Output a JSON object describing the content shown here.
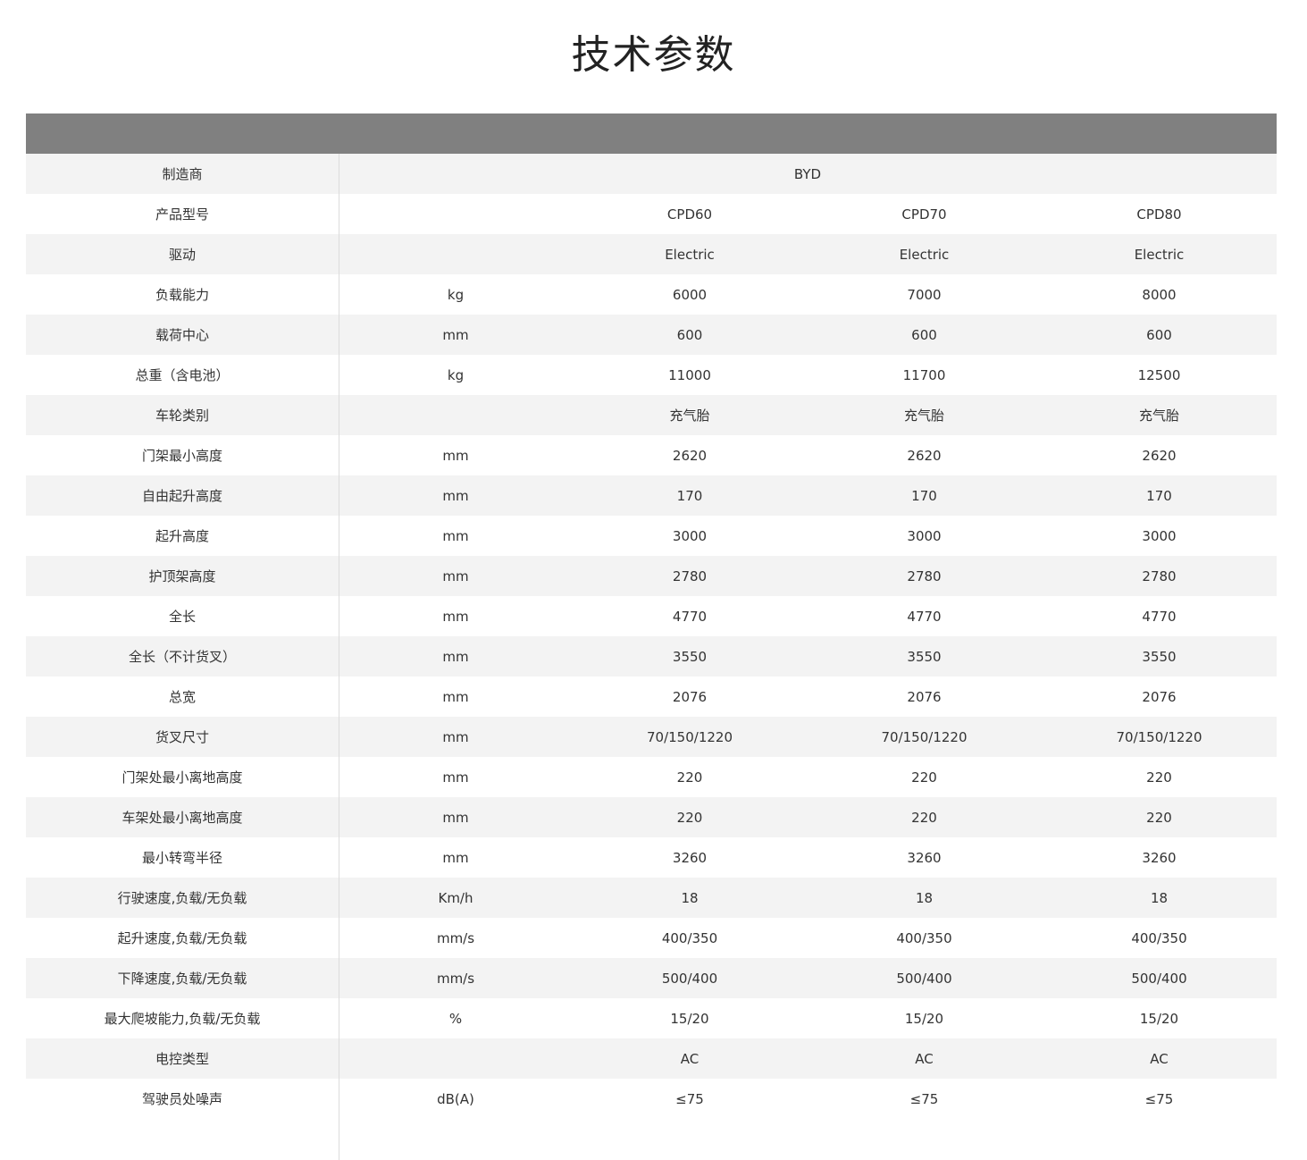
{
  "page": {
    "title": "技术参数"
  },
  "manufacturer": {
    "label": "制造商",
    "value": "BYD"
  },
  "rows": [
    {
      "label": "产品型号",
      "unit": "",
      "values": [
        "CPD60",
        "CPD70",
        "CPD80"
      ]
    },
    {
      "label": "驱动",
      "unit": "",
      "values": [
        "Electric",
        "Electric",
        "Electric"
      ]
    },
    {
      "label": "负载能力",
      "unit": "kg",
      "values": [
        "6000",
        "7000",
        "8000"
      ]
    },
    {
      "label": "载荷中心",
      "unit": "mm",
      "values": [
        "600",
        "600",
        "600"
      ]
    },
    {
      "label": "总重（含电池）",
      "unit": "kg",
      "values": [
        "11000",
        "11700",
        "12500"
      ]
    },
    {
      "label": "车轮类别",
      "unit": "",
      "values": [
        "充气胎",
        "充气胎",
        "充气胎"
      ]
    },
    {
      "label": "门架最小高度",
      "unit": "mm",
      "values": [
        "2620",
        "2620",
        "2620"
      ]
    },
    {
      "label": "自由起升高度",
      "unit": "mm",
      "values": [
        "170",
        "170",
        "170"
      ]
    },
    {
      "label": "起升高度",
      "unit": "mm",
      "values": [
        "3000",
        "3000",
        "3000"
      ]
    },
    {
      "label": "护顶架高度",
      "unit": "mm",
      "values": [
        "2780",
        "2780",
        "2780"
      ]
    },
    {
      "label": "全长",
      "unit": "mm",
      "values": [
        "4770",
        "4770",
        "4770"
      ]
    },
    {
      "label": "全长（不计货叉）",
      "unit": "mm",
      "values": [
        "3550",
        "3550",
        "3550"
      ]
    },
    {
      "label": "总宽",
      "unit": "mm",
      "values": [
        "2076",
        "2076",
        "2076"
      ]
    },
    {
      "label": "货叉尺寸",
      "unit": "mm",
      "values": [
        "70/150/1220",
        "70/150/1220",
        "70/150/1220"
      ]
    },
    {
      "label": "门架处最小离地高度",
      "unit": "mm",
      "values": [
        "220",
        "220",
        "220"
      ]
    },
    {
      "label": "车架处最小离地高度",
      "unit": "mm",
      "values": [
        "220",
        "220",
        "220"
      ]
    },
    {
      "label": "最小转弯半径",
      "unit": "mm",
      "values": [
        "3260",
        "3260",
        "3260"
      ]
    },
    {
      "label": "行驶速度,负载/无负载",
      "unit": "Km/h",
      "values": [
        "18",
        "18",
        "18"
      ]
    },
    {
      "label": "起升速度,负载/无负载",
      "unit": "mm/s",
      "values": [
        "400/350",
        "400/350",
        "400/350"
      ]
    },
    {
      "label": "下降速度,负载/无负载",
      "unit": "mm/s",
      "values": [
        "500/400",
        "500/400",
        "500/400"
      ]
    },
    {
      "label": "最大爬坡能力,负载/无负载",
      "unit": "%",
      "values": [
        "15/20",
        "15/20",
        "15/20"
      ]
    },
    {
      "label": "电控类型",
      "unit": "",
      "values": [
        "AC",
        "AC",
        "AC"
      ]
    },
    {
      "label": "驾驶员处噪声",
      "unit": "dB(A)",
      "values": [
        "≤75",
        "≤75",
        "≤75"
      ]
    }
  ],
  "colors": {
    "header_bar": "#808080",
    "row_shade": "#f3f3f3",
    "divider": "#dcdcdc",
    "text": "#333333"
  }
}
